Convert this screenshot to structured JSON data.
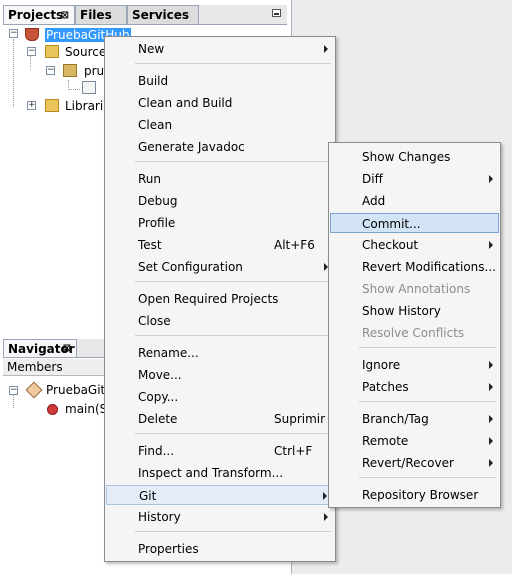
{
  "projects_panel": {
    "tabs": [
      "Projects",
      "Files",
      "Services"
    ],
    "tab_close_glyph": "⊠",
    "tree": {
      "project": "PruebaGitHub",
      "source_node": "Source P",
      "package_node": "prue",
      "libraries": "Libraries"
    }
  },
  "navigator_panel": {
    "tab": "Navigator",
    "members_header": "Members",
    "class_node": "PruebaGitHub",
    "method_node": "main(Stri"
  },
  "context_menu": {
    "items": [
      {
        "label": "New",
        "submenu": true
      },
      {
        "label": "Build"
      },
      {
        "label": "Clean and Build"
      },
      {
        "label": "Clean"
      },
      {
        "label": "Generate Javadoc"
      },
      {
        "label": "Run"
      },
      {
        "label": "Debug"
      },
      {
        "label": "Profile"
      },
      {
        "label": "Test",
        "shortcut": "Alt+F6"
      },
      {
        "label": "Set Configuration",
        "submenu": true
      },
      {
        "label": "Open Required Projects"
      },
      {
        "label": "Close"
      },
      {
        "label": "Rename..."
      },
      {
        "label": "Move..."
      },
      {
        "label": "Copy..."
      },
      {
        "label": "Delete",
        "shortcut": "Suprimir"
      },
      {
        "label": "Find...",
        "shortcut": "Ctrl+F"
      },
      {
        "label": "Inspect and Transform..."
      },
      {
        "label": "Git",
        "submenu": true
      },
      {
        "label": "History",
        "submenu": true
      },
      {
        "label": "Properties"
      }
    ]
  },
  "git_submenu": {
    "items": [
      {
        "label": "Show Changes"
      },
      {
        "label": "Diff",
        "submenu": true
      },
      {
        "label": "Add"
      },
      {
        "label": "Commit..."
      },
      {
        "label": "Checkout",
        "submenu": true
      },
      {
        "label": "Revert Modifications..."
      },
      {
        "label": "Show Annotations",
        "disabled": true
      },
      {
        "label": "Show History"
      },
      {
        "label": "Resolve Conflicts",
        "disabled": true
      },
      {
        "label": "Ignore",
        "submenu": true
      },
      {
        "label": "Patches",
        "submenu": true
      },
      {
        "label": "Branch/Tag",
        "submenu": true
      },
      {
        "label": "Remote",
        "submenu": true
      },
      {
        "label": "Revert/Recover",
        "submenu": true
      },
      {
        "label": "Repository Browser"
      }
    ]
  },
  "colors": {
    "selection": "#3399ff",
    "menu_highlight": "#d3e4f7",
    "menu_highlight_border": "#7da2ce",
    "disabled_text": "#8c8c8c"
  }
}
